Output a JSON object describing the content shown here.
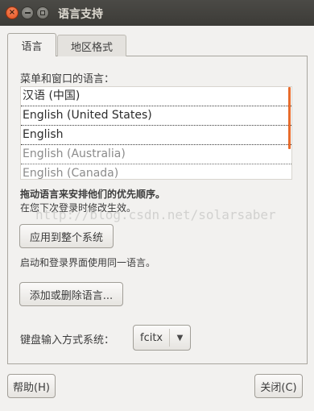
{
  "window": {
    "title": "语言支持"
  },
  "titlebar_icons": [
    "close-icon",
    "minimize-icon",
    "maximize-icon"
  ],
  "tabs": [
    {
      "label": "语言",
      "active": true
    },
    {
      "label": "地区格式",
      "active": false
    }
  ],
  "languages": {
    "heading": "菜单和窗口的语言：",
    "items": [
      {
        "label": "汉语 (中国)",
        "enabled": true
      },
      {
        "label": "English (United States)",
        "enabled": true
      },
      {
        "label": "English",
        "enabled": true
      },
      {
        "label": "English (Australia)",
        "enabled": false
      },
      {
        "label": "English (Canada)",
        "enabled": false
      }
    ],
    "hint_bold": "拖动语言来安排他们的优先顺序。",
    "hint": "在您下次登录时修改生效。"
  },
  "watermark": "http://blog.csdn.net/solarsaber",
  "apply_button": "应用到整个系统",
  "apply_note": "启动和登录界面使用同一语言。",
  "install_button": "添加或删除语言...",
  "input_method": {
    "label": "键盘输入方式系统：",
    "value": "fcitx"
  },
  "footer": {
    "help_button": "帮助(H)",
    "close_button": "关闭(C)"
  },
  "colors": {
    "titlebar": "#3c3b37",
    "close_button": "#e4501c",
    "scroll_indicator": "#e86c2c",
    "window_bg": "#f2f1ef"
  }
}
